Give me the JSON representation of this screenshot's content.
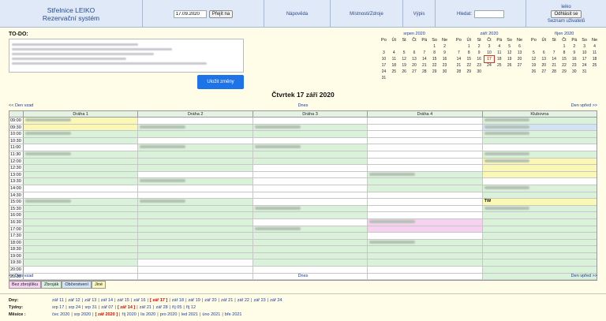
{
  "header": {
    "title_line1": "Střelnice LEIKO",
    "title_line2": "Rezervační systém",
    "date_value": "17.09.2020",
    "go_button": "Přejít na",
    "help": "Nápověda",
    "rooms": "Místnosti/Zdroje",
    "export": "Výpis",
    "search_label": "Hledat:",
    "search_value": "",
    "username": "leiko",
    "logout_button": "Odhlásit se",
    "user_list": "Seznam uživatelů"
  },
  "todo": {
    "label": "TO-DO:",
    "save_button": "Uložit změny"
  },
  "calendars": [
    {
      "title": "srpen 2020",
      "days": [
        "Po",
        "Út",
        "St",
        "Čt",
        "Pá",
        "So",
        "Ne"
      ],
      "weeks": [
        [
          "",
          "",
          "",
          "",
          "",
          "1",
          "2"
        ],
        [
          "3",
          "4",
          "5",
          "6",
          "7",
          "8",
          "9"
        ],
        [
          "10",
          "11",
          "12",
          "13",
          "14",
          "15",
          "16"
        ],
        [
          "17",
          "18",
          "19",
          "20",
          "21",
          "22",
          "23"
        ],
        [
          "24",
          "25",
          "26",
          "27",
          "28",
          "29",
          "30"
        ],
        [
          "31",
          "",
          "",
          "",
          "",
          "",
          ""
        ]
      ]
    },
    {
      "title": "září 2020",
      "days": [
        "Po",
        "Út",
        "St",
        "Čt",
        "Pá",
        "So",
        "Ne"
      ],
      "weeks": [
        [
          "",
          "1",
          "2",
          "3",
          "4",
          "5",
          "6"
        ],
        [
          "7",
          "8",
          "9",
          "10",
          "11",
          "12",
          "13"
        ],
        [
          "14",
          "15",
          "16",
          "17",
          "18",
          "19",
          "20"
        ],
        [
          "21",
          "22",
          "23",
          "24",
          "25",
          "26",
          "27"
        ],
        [
          "28",
          "29",
          "30",
          "",
          "",
          "",
          ""
        ]
      ]
    },
    {
      "title": "říjen 2020",
      "days": [
        "Po",
        "Út",
        "St",
        "Čt",
        "Pá",
        "So",
        "Ne"
      ],
      "weeks": [
        [
          "",
          "",
          "",
          "1",
          "2",
          "3",
          "4"
        ],
        [
          "5",
          "6",
          "7",
          "8",
          "9",
          "10",
          "11"
        ],
        [
          "12",
          "13",
          "14",
          "15",
          "16",
          "17",
          "18"
        ],
        [
          "19",
          "20",
          "21",
          "22",
          "23",
          "24",
          "25"
        ],
        [
          "26",
          "27",
          "28",
          "29",
          "30",
          "31",
          ""
        ]
      ]
    }
  ],
  "selected_day": "17",
  "day_title": "Čtvrtek 17 září 2020",
  "nav": {
    "prev": "<< Den vzad",
    "today": "Dnes",
    "next": "Den vpřed >>"
  },
  "columns": [
    "Dráha 1",
    "Dráha 2",
    "Dráha 3",
    "Dráha 4",
    "Klubovna"
  ],
  "times": [
    "09:00",
    "09:30",
    "10:00",
    "10:30",
    "11:00",
    "11:30",
    "12:00",
    "12:30",
    "13:00",
    "13:30",
    "14:00",
    "14:30",
    "15:00",
    "15:30",
    "16:00",
    "16:30",
    "17:00",
    "17:30",
    "18:00",
    "18:30",
    "19:00",
    "19:30",
    "20:00",
    "20:30"
  ],
  "cells": [
    [
      "y",
      "e",
      "e",
      "e",
      "g"
    ],
    [
      "y",
      "g",
      "g",
      "e",
      "b"
    ],
    [
      "g",
      "g",
      "g",
      "e",
      "g"
    ],
    [
      "g",
      "e",
      "e",
      "e",
      "g"
    ],
    [
      "e",
      "g",
      "g",
      "e",
      "e"
    ],
    [
      "g",
      "g",
      "g",
      "e",
      "g"
    ],
    [
      "g",
      "g",
      "g",
      "e",
      "y"
    ],
    [
      "g",
      "g",
      "e",
      "e",
      "y"
    ],
    [
      "g",
      "e",
      "e",
      "g",
      "y"
    ],
    [
      "g",
      "g",
      "e",
      "g",
      "e"
    ],
    [
      "e",
      "e",
      "e",
      "g",
      "g"
    ],
    [
      "e",
      "e",
      "e",
      "e",
      "g"
    ],
    [
      "g",
      "g",
      "e",
      "e",
      "y"
    ],
    [
      "g",
      "g",
      "g",
      "e",
      "g"
    ],
    [
      "g",
      "g",
      "g",
      "e",
      "g"
    ],
    [
      "g",
      "g",
      "e",
      "p",
      "g"
    ],
    [
      "g",
      "g",
      "g",
      "p",
      "g"
    ],
    [
      "g",
      "g",
      "g",
      "e",
      "g"
    ],
    [
      "g",
      "g",
      "g",
      "g",
      "g"
    ],
    [
      "g",
      "g",
      "g",
      "g",
      "g"
    ],
    [
      "g",
      "g",
      "g",
      "g",
      "g"
    ],
    [
      "g",
      "e",
      "g",
      "g",
      "g"
    ],
    [
      "e",
      "e",
      "e",
      "e",
      "g"
    ],
    [
      "e",
      "e",
      "e",
      "e",
      "g"
    ]
  ],
  "cell_labels": [
    {
      "row": 12,
      "col": 4,
      "text": "TW"
    }
  ],
  "legend": [
    {
      "label": "Bez zbrojíšku",
      "color": "#f6d1f0"
    },
    {
      "label": "Zbroják",
      "color": "#d9f2d9"
    },
    {
      "label": "Občerstvení",
      "color": "#d2e3f5"
    },
    {
      "label": "Jiné",
      "color": "#fbf7b5"
    }
  ],
  "bottom": {
    "days_label": "Dny:",
    "days": [
      "zář 11",
      "zář 12",
      "zář 13",
      "zář 14",
      "zář 15",
      "zář 16",
      "zář 17",
      "zář 18",
      "zář 19",
      "zář 20",
      "zář 21",
      "zář 22",
      "zář 23",
      "zář 24"
    ],
    "days_current": "zář 17",
    "weeks_label": "Týdny:",
    "weeks": [
      "srp 17",
      "srp 24",
      "srp 31",
      "zář 07",
      "zář 14",
      "zář 21",
      "zář 28",
      "říj 05",
      "říj 12"
    ],
    "weeks_current": "zář 14",
    "months_label": "Měsíce :",
    "months": [
      "čec 2020",
      "srp 2020",
      "zář 2020",
      "říj 2020",
      "lis 2020",
      "pro 2020",
      "led 2021",
      "úno 2021",
      "bře 2021"
    ],
    "months_current": "zář 2020"
  }
}
